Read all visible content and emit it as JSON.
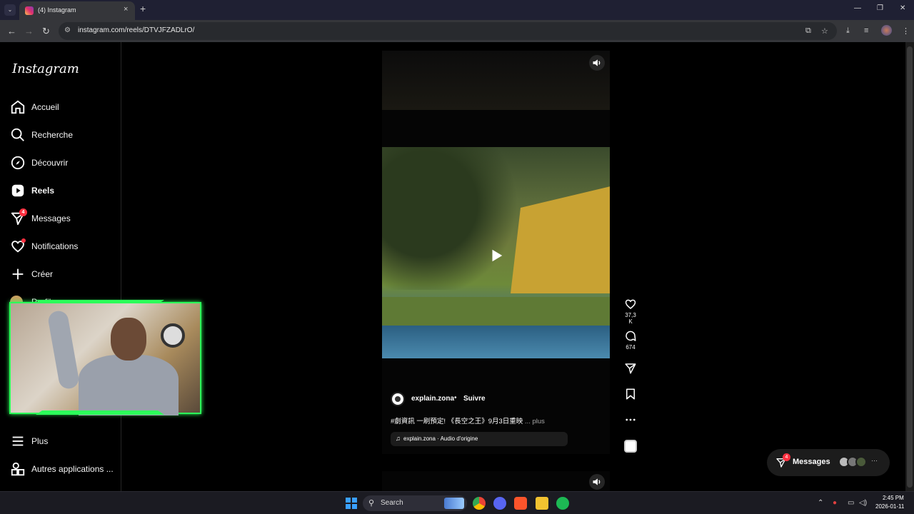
{
  "browser": {
    "tab_title": "(4) Instagram",
    "tab_close": "×",
    "new_tab": "+",
    "url": "instagram.com/reels/DTVJFZADLrO/",
    "window_minimize": "—",
    "window_restore": "❐",
    "window_close": "✕"
  },
  "sidebar": {
    "logo": "Instagram",
    "items": [
      {
        "label": "Accueil",
        "icon": "home-icon"
      },
      {
        "label": "Recherche",
        "icon": "search-icon"
      },
      {
        "label": "Découvrir",
        "icon": "compass-icon"
      },
      {
        "label": "Reels",
        "icon": "reels-icon"
      },
      {
        "label": "Messages",
        "icon": "messenger-icon",
        "badge": "4"
      },
      {
        "label": "Notifications",
        "icon": "heart-icon"
      },
      {
        "label": "Créer",
        "icon": "plus-icon"
      },
      {
        "label": "Profil",
        "icon": "profile-avatar"
      }
    ],
    "bottom_items": [
      {
        "label": "Plus",
        "icon": "menu-icon"
      },
      {
        "label": "Autres applications ...",
        "icon": "apps-icon"
      }
    ]
  },
  "reel": {
    "author": "explain.zona",
    "separator": "•",
    "follow": "Suivre",
    "caption": "#劇資訊 一刷預定! 《長空之王》9月3日重映",
    "caption_more": "... plus",
    "audio": "explain.zona · Audio d'origine",
    "likes": "37,3 K",
    "comments": "674"
  },
  "messages_float": {
    "label": "Messages",
    "badge": "4",
    "more": "···"
  },
  "taskbar": {
    "search_placeholder": "Search",
    "time": "2:45 PM",
    "date": "2026-01-11"
  },
  "colors": {
    "accent_badge": "#ff3040",
    "webcam_frame": "#2cff5a",
    "chrome_bg": "#35363a",
    "tab_bar_bg": "#1f2033"
  }
}
